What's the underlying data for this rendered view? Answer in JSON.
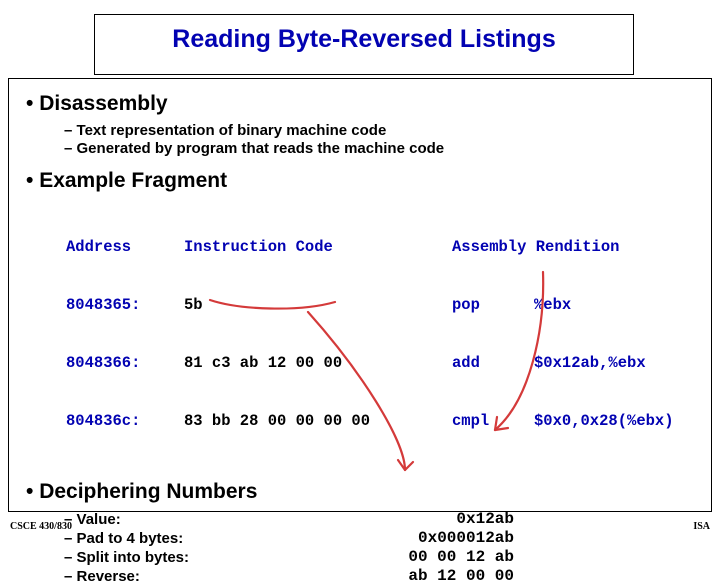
{
  "title": "Reading Byte-Reversed Listings",
  "sections": {
    "disassembly": {
      "heading": "Disassembly",
      "points": [
        "Text representation of binary machine code",
        "Generated by program that reads the machine code"
      ]
    },
    "example": {
      "heading": "Example Fragment",
      "table": {
        "headers": {
          "addr": "Address",
          "code": "Instruction Code",
          "asm": "Assembly Rendition"
        },
        "rows": [
          {
            "addr": "8048365:",
            "code": "5b",
            "mnem": "pop",
            "oper": "%ebx"
          },
          {
            "addr": "8048366:",
            "code": "81 c3 ab 12 00 00",
            "mnem": "add",
            "oper": "$0x12ab,%ebx"
          },
          {
            "addr": "804836c:",
            "code": "83 bb 28 00 00 00 00",
            "mnem": "cmpl",
            "oper": "$0x0,0x28(%ebx)"
          }
        ]
      }
    },
    "decipher": {
      "heading": "Deciphering Numbers",
      "rows": [
        {
          "label": "Value:",
          "val": "    0x12ab"
        },
        {
          "label": "Pad to 4 bytes:",
          "val": "0x000012ab"
        },
        {
          "label": "Split into bytes:",
          "val": "00 00 12 ab"
        },
        {
          "label": "Reverse:",
          "val": "ab 12 00 00"
        }
      ]
    }
  },
  "footer": {
    "left": "CSCE 430/830",
    "right": "ISA"
  }
}
